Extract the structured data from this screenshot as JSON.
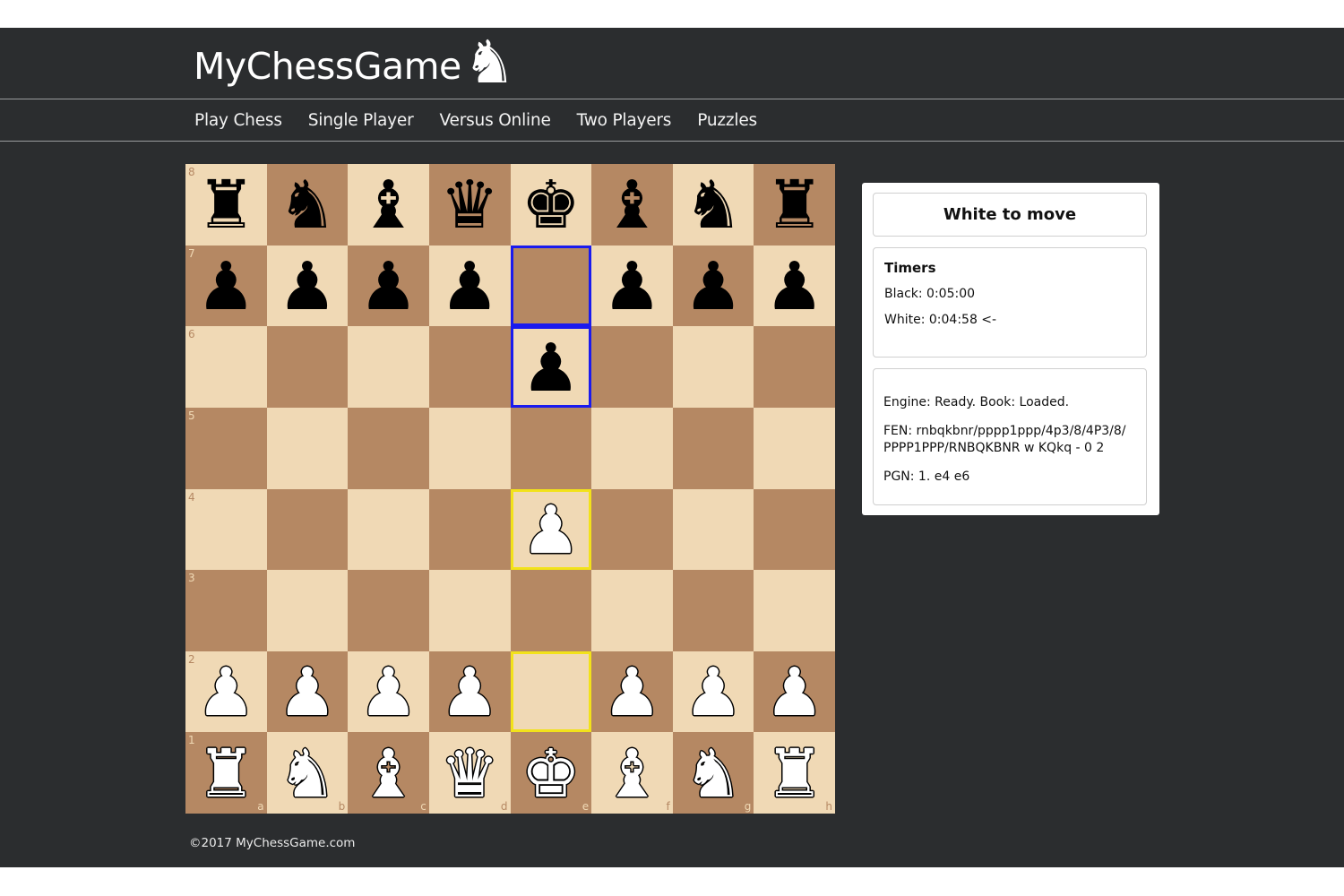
{
  "header": {
    "logo_text": "MyChessGame",
    "logo_icon": "knight-icon"
  },
  "nav": {
    "items": [
      {
        "label": "Play Chess"
      },
      {
        "label": "Single Player"
      },
      {
        "label": "Versus Online"
      },
      {
        "label": "Two Players"
      },
      {
        "label": "Puzzles"
      }
    ]
  },
  "board": {
    "files": [
      "a",
      "b",
      "c",
      "d",
      "e",
      "f",
      "g",
      "h"
    ],
    "ranks": [
      "8",
      "7",
      "6",
      "5",
      "4",
      "3",
      "2",
      "1"
    ],
    "light_color": "#f0d9b5",
    "dark_color": "#b58863",
    "position": [
      [
        "r",
        "n",
        "b",
        "q",
        "k",
        "b",
        "n",
        "r"
      ],
      [
        "p",
        "p",
        "p",
        "p",
        "",
        "p",
        "p",
        "p"
      ],
      [
        "",
        "",
        "",
        "",
        "p",
        "",
        "",
        ""
      ],
      [
        "",
        "",
        "",
        "",
        "",
        "",
        "",
        ""
      ],
      [
        "",
        "",
        "",
        "",
        "P",
        "",
        "",
        ""
      ],
      [
        "",
        "",
        "",
        "",
        "",
        "",
        "",
        ""
      ],
      [
        "P",
        "P",
        "P",
        "P",
        "",
        "P",
        "P",
        "P"
      ],
      [
        "R",
        "N",
        "B",
        "Q",
        "K",
        "B",
        "N",
        "R"
      ]
    ],
    "highlights": {
      "last_move_black": [
        "e7",
        "e6"
      ],
      "last_move_white": [
        "e2",
        "e4"
      ],
      "black_color": "#1a1aee",
      "white_color": "#f2e21a"
    }
  },
  "panel": {
    "status": "White to move",
    "timers_title": "Timers",
    "black_timer": "Black: 0:05:00",
    "white_timer": "White: 0:04:58 <-",
    "engine": "Engine: Ready. Book: Loaded.",
    "fen": "FEN: rnbqkbnr/pppp1ppp/4p3/8/4P3/8/ PPPP1PPP/RNBQKBNR w KQkq - 0 2",
    "pgn": "PGN: 1. e4 e6"
  },
  "footer": {
    "copyright": "©2017 MyChessGame.com"
  }
}
